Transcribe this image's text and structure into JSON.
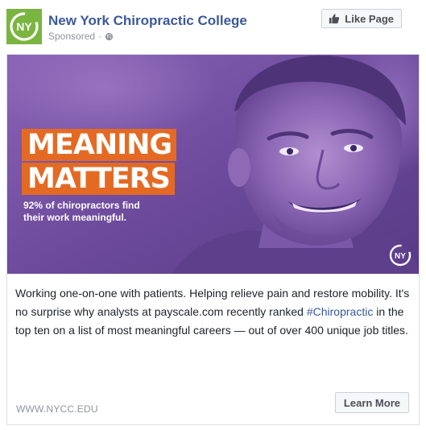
{
  "header": {
    "page_name": "New York Chiropractic College",
    "sponsored_label": "Sponsored",
    "separator": "·",
    "avatar_text": "NY",
    "like_button_label": "Like Page"
  },
  "ad": {
    "headline_line1": "MEANING",
    "headline_line2": "MATTERS",
    "subhead": "92% of chiropractors find their work meaningful.",
    "watermark_text": "NY",
    "body_before": "Working one-on-one with patients. Helping relieve pain and restore mobility. It's no surprise why analysts at payscale.com recently ranked ",
    "hashtag": "#Chiropractic",
    "body_after": " in the top ten on a list of most meaningful careers — out of over 400 unique job titles.",
    "display_url": "WWW.NYCC.EDU",
    "cta_label": "Learn More"
  },
  "colors": {
    "brand_green": "#7ab540",
    "facebook_blue": "#3b5998",
    "overlay_purple": "#6f4a9c",
    "headline_orange": "#e46a24"
  },
  "icons": {
    "avatar": "nycc-logo-icon",
    "audience": "globe-icon",
    "like": "thumbs-up-icon",
    "watermark": "nycc-watermark-icon"
  }
}
